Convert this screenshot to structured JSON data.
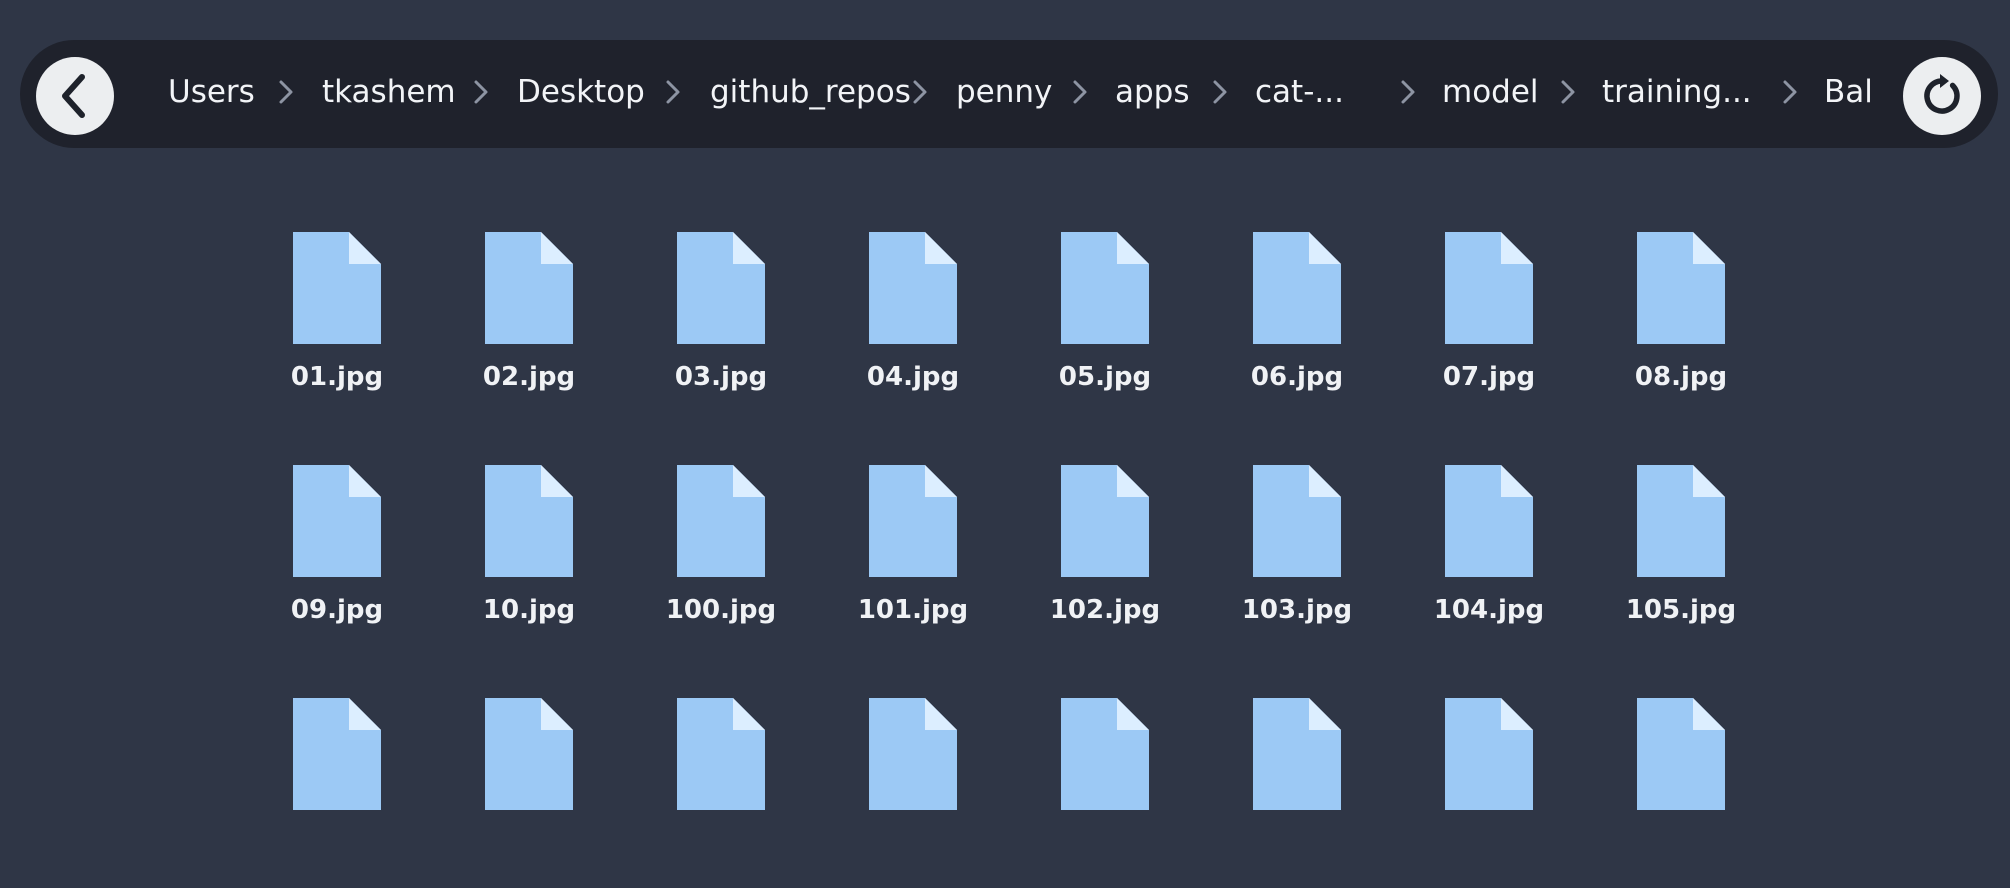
{
  "toolbar": {
    "back_icon": "chevron-left-icon",
    "refresh_icon": "refresh-icon",
    "separator_icon": "chevron-right-icon"
  },
  "breadcrumb": [
    "Users",
    "tkashem",
    "Desktop",
    "github_repos",
    "penny",
    "apps",
    "cat-...",
    "model",
    "training...",
    "Bal"
  ],
  "files": [
    "01.jpg",
    "02.jpg",
    "03.jpg",
    "04.jpg",
    "05.jpg",
    "06.jpg",
    "07.jpg",
    "08.jpg",
    "09.jpg",
    "10.jpg",
    "100.jpg",
    "101.jpg",
    "102.jpg",
    "103.jpg",
    "104.jpg",
    "105.jpg",
    "",
    "",
    "",
    "",
    "",
    "",
    "",
    ""
  ],
  "colors": {
    "background": "#2f3646",
    "bar": "#1f222c",
    "file_icon": "#9cc9f5",
    "file_fold": "#dceeff"
  }
}
